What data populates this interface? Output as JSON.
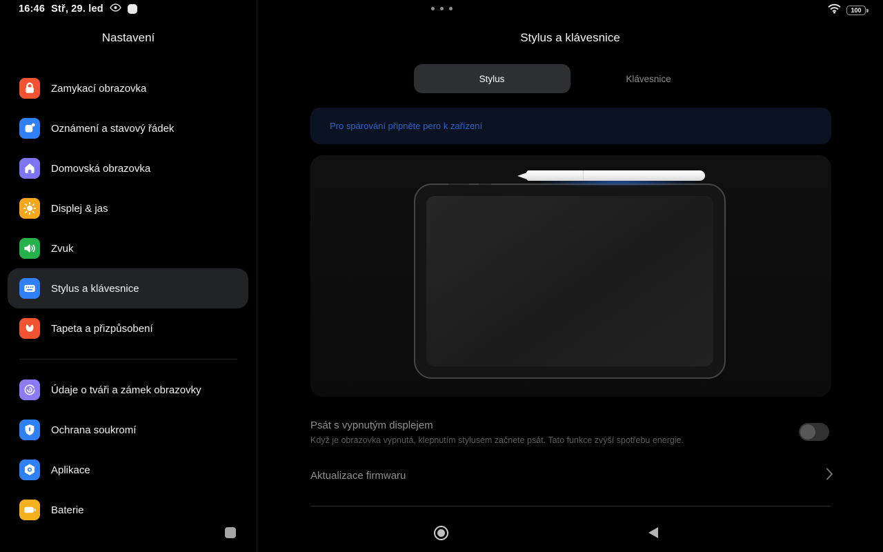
{
  "status_bar": {
    "time": "16:46",
    "date": "Stř, 29. led",
    "battery_percent": "100"
  },
  "sidebar": {
    "title": "Nastavení",
    "items": [
      {
        "label": "Zamykací obrazovka",
        "icon": "lock-icon",
        "color": "#f25330",
        "selected": false
      },
      {
        "label": "Oznámení a stavový řádek",
        "icon": "notifications-icon",
        "color": "#2f80f5",
        "selected": false
      },
      {
        "label": "Domovská obrazovka",
        "icon": "home-screen-icon",
        "color": "#7d74f2",
        "selected": false
      },
      {
        "label": "Displej & jas",
        "icon": "brightness-icon",
        "color": "#f2a71d",
        "selected": false
      },
      {
        "label": "Zvuk",
        "icon": "sound-icon",
        "color": "#25b24c",
        "selected": false
      },
      {
        "label": "Stylus a klávesnice",
        "icon": "keyboard-icon",
        "color": "#2f80f5",
        "selected": true
      },
      {
        "label": "Tapeta a přizpůsobení",
        "icon": "wallpaper-icon",
        "color": "#f25330",
        "selected": false
      }
    ],
    "items_secondary": [
      {
        "label": "Údaje o tváři a zámek obrazovky",
        "icon": "face-unlock-icon",
        "color": "#8d7bf5"
      },
      {
        "label": "Ochrana soukromí",
        "icon": "privacy-shield-icon",
        "color": "#2f80f5"
      },
      {
        "label": "Aplikace",
        "icon": "apps-icon",
        "color": "#2f80f5"
      },
      {
        "label": "Baterie",
        "icon": "battery-icon",
        "color": "#f2b11d"
      }
    ]
  },
  "content": {
    "title": "Stylus a klávesnice",
    "tabs": [
      {
        "label": "Stylus",
        "selected": true
      },
      {
        "label": "Klávesnice",
        "selected": false
      }
    ],
    "banner_text": "Pro spárování připněte pero k zařízení",
    "write_off_title": "Psát s vypnutým displejem",
    "write_off_subtitle": "Když je obrazovka vypnutá, klepnutím stylusem začnete psát. Tato funkce zvýší spotřebu energie.",
    "write_off_state": "off",
    "firmware_label": "Aktualizace firmwaru"
  },
  "colors": {
    "accent_blue": "#2e63c9",
    "banner_bg": "#0b1322",
    "selected_row_bg": "#222326",
    "active_tab_bg": "#2d2f32",
    "lock_icon_bg": "#f25330",
    "notifications_icon_bg": "#2f80f5",
    "home_screen_icon_bg": "#7d74f2",
    "brightness_icon_bg": "#f2a71d",
    "sound_icon_bg": "#25b24c",
    "keyboard_icon_bg": "#2f80f5",
    "wallpaper_icon_bg": "#f25330",
    "face_unlock_icon_bg": "#8d7bf5",
    "privacy_icon_bg": "#2f80f5",
    "apps_icon_bg": "#2f80f5",
    "battery_icon_bg": "#f2b11d"
  }
}
